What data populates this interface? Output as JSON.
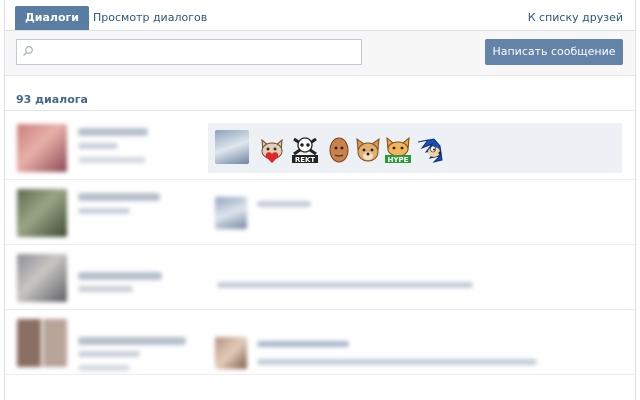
{
  "tabs": {
    "active": "Диалоги",
    "second": "Просмотр диалогов",
    "right_link": "К списку друзей"
  },
  "search": {
    "placeholder": "",
    "value": ""
  },
  "toolbar": {
    "write_label": "Написать сообщение"
  },
  "dialogs": {
    "count_label": "93 диалога"
  },
  "colors": {
    "accent": "#597da3",
    "button": "#6383a8",
    "link": "#2b587a",
    "heading": "#45688e",
    "selected_row_bg": "#edf1f5"
  },
  "emojis": [
    "cat-love-emoji",
    "rekt-skull-emoji",
    "head-emoji",
    "doge-emoji",
    "hype-cat-emoji",
    "sonic-emoji"
  ]
}
